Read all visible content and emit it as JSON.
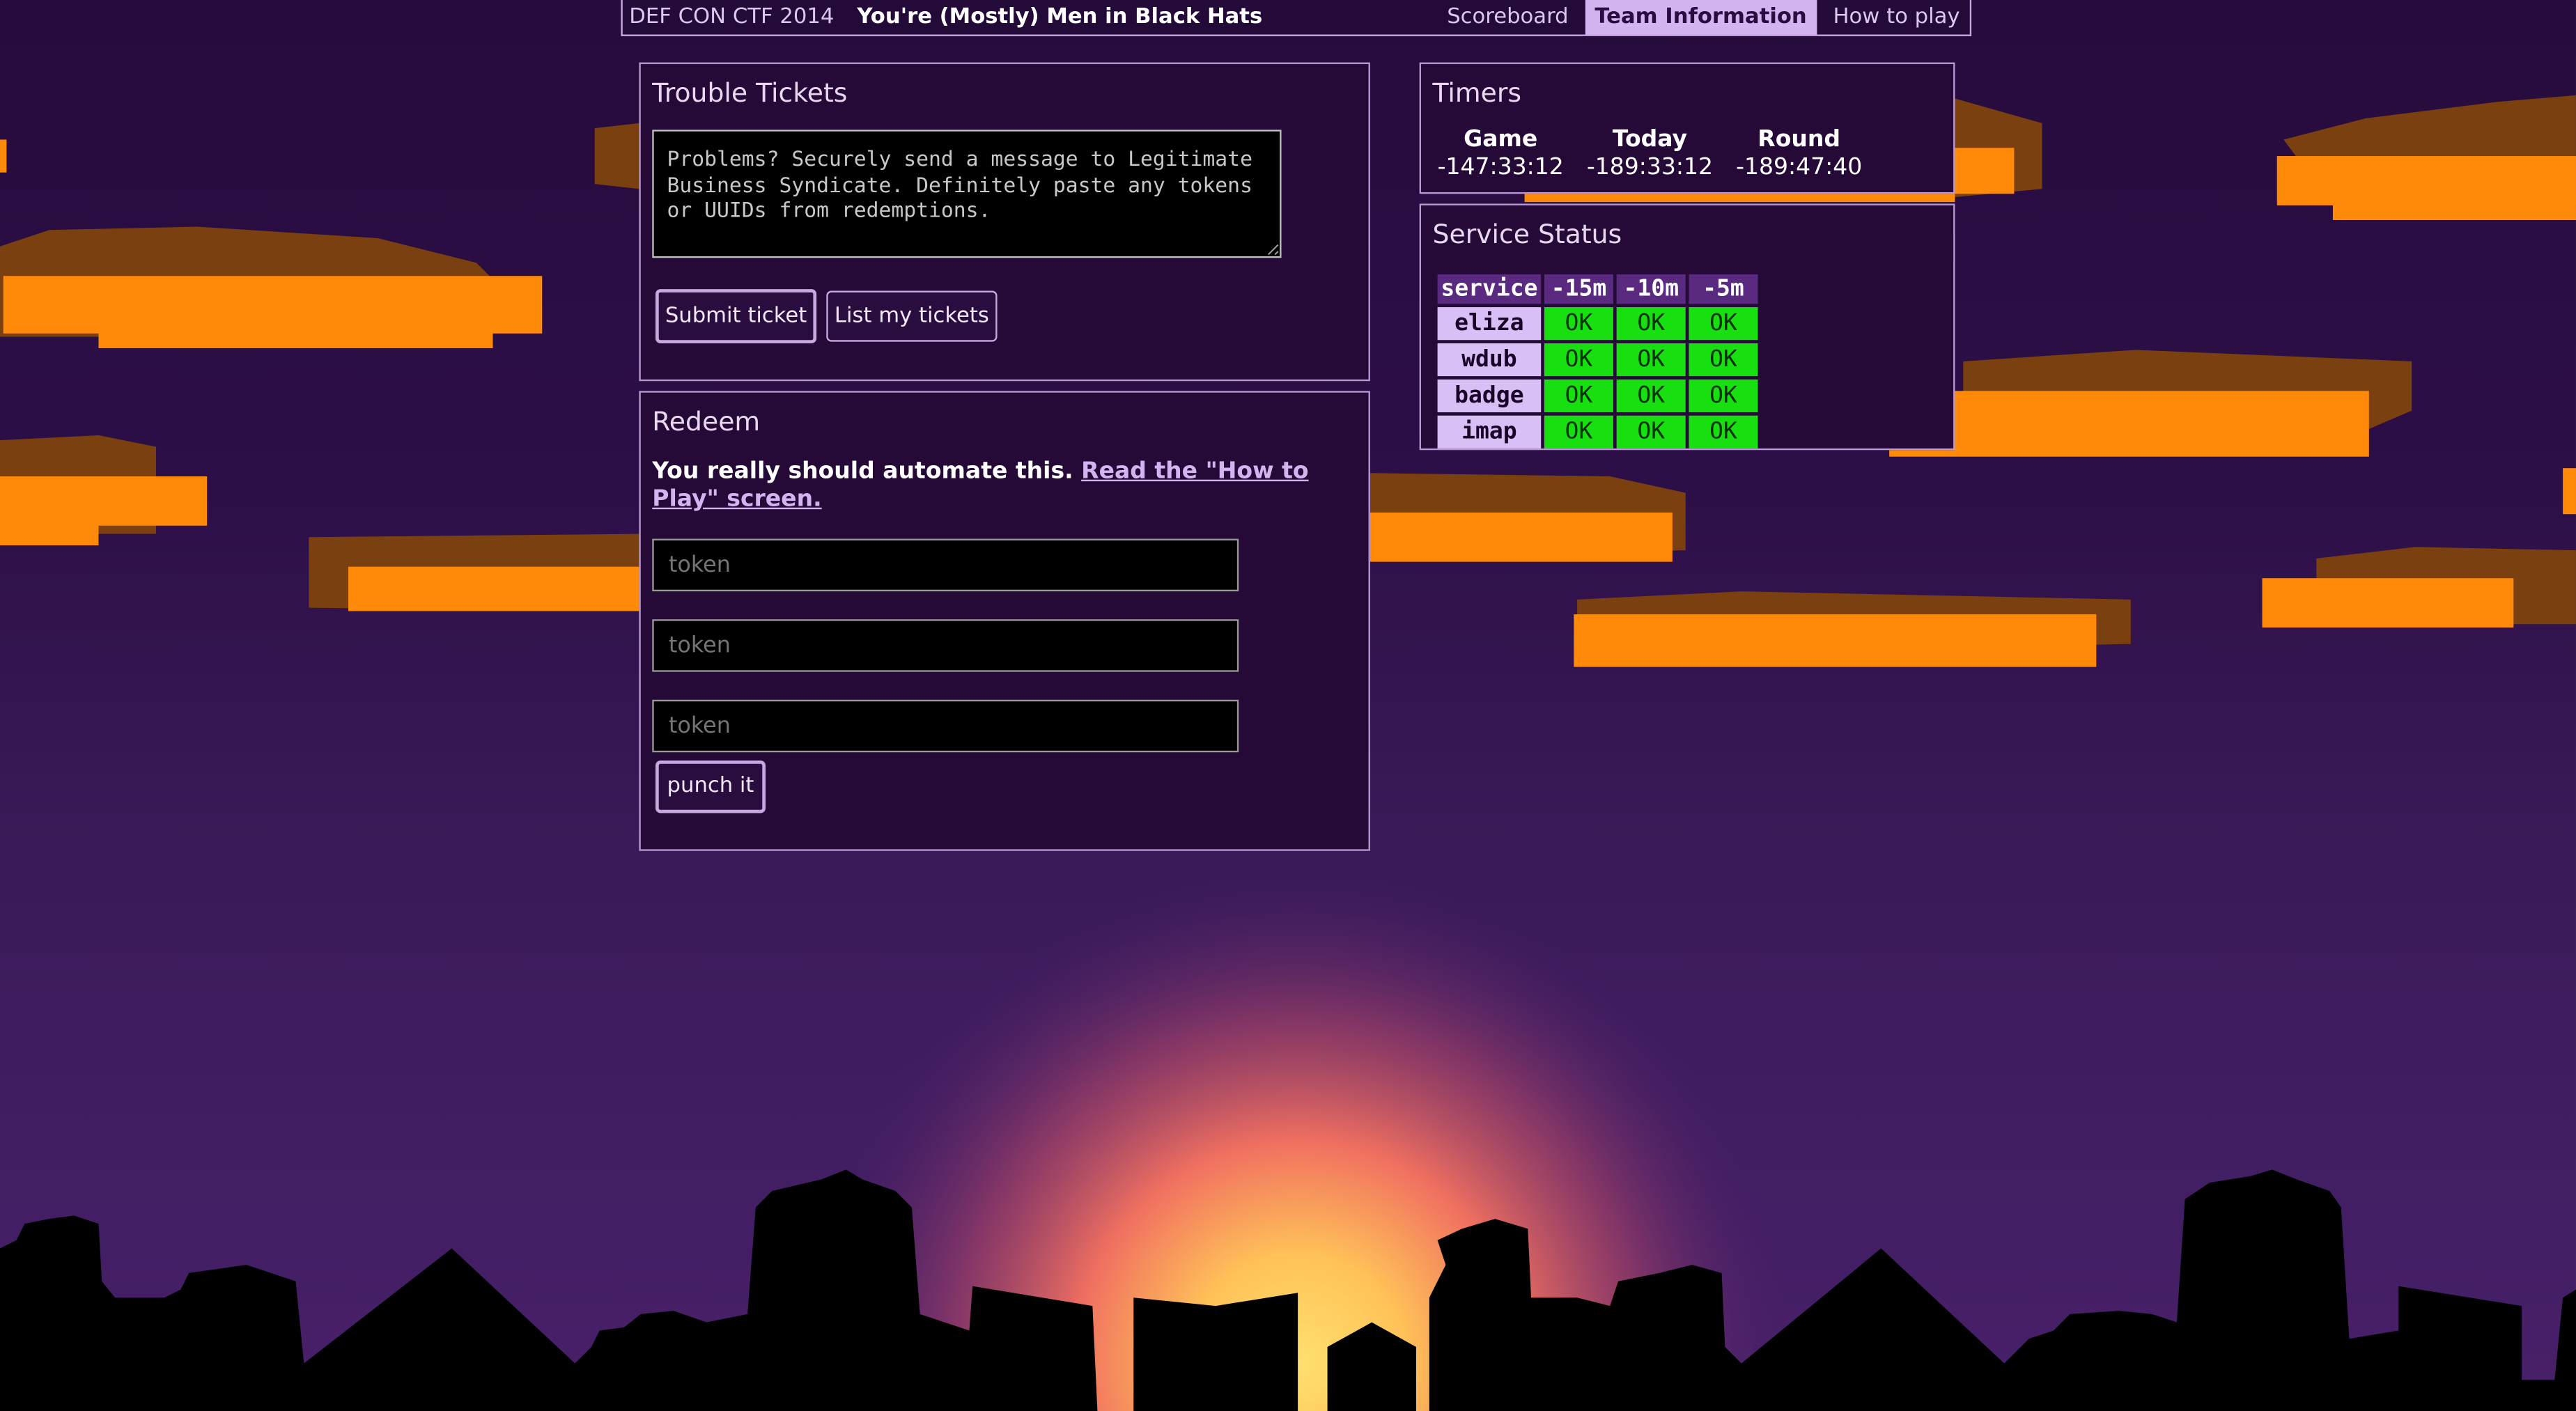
{
  "nav": {
    "brand": "DEF CON CTF 2014",
    "team": "You're (Mostly) Men in Black Hats",
    "links": [
      "Scoreboard",
      "Team Information",
      "How to play"
    ]
  },
  "tickets": {
    "title": "Trouble Tickets",
    "textarea_text": "Problems? Securely send a message to Legitimate Business Syndicate. Definitely paste any tokens or UUIDs from redemptions.",
    "submit_label": "Submit ticket",
    "list_label": "List my tickets"
  },
  "redeem": {
    "title": "Redeem",
    "note": "You really should automate this.",
    "link_text": "Read the \"How to Play\" screen.",
    "placeholder": "token",
    "punch_label": "punch it"
  },
  "timers": {
    "title": "Timers",
    "items": [
      {
        "label": "Game",
        "value": "-147:33:12"
      },
      {
        "label": "Today",
        "value": "-189:33:12"
      },
      {
        "label": "Round",
        "value": "-189:47:40"
      }
    ]
  },
  "status": {
    "title": "Service Status",
    "headers": [
      "service",
      "-15m",
      "-10m",
      "-5m"
    ],
    "rows": [
      {
        "service": "eliza",
        "cells": [
          "OK",
          "OK",
          "OK"
        ]
      },
      {
        "service": "wdub",
        "cells": [
          "OK",
          "OK",
          "OK"
        ]
      },
      {
        "service": "badge",
        "cells": [
          "OK",
          "OK",
          "OK"
        ]
      },
      {
        "service": "imap",
        "cells": [
          "OK",
          "OK",
          "OK"
        ]
      }
    ]
  },
  "colors": {
    "accent": "#d4b4f0",
    "cloud_orange": "#ff8a0a",
    "cloud_brown": "#7a4010",
    "ok_green": "#18e010"
  }
}
